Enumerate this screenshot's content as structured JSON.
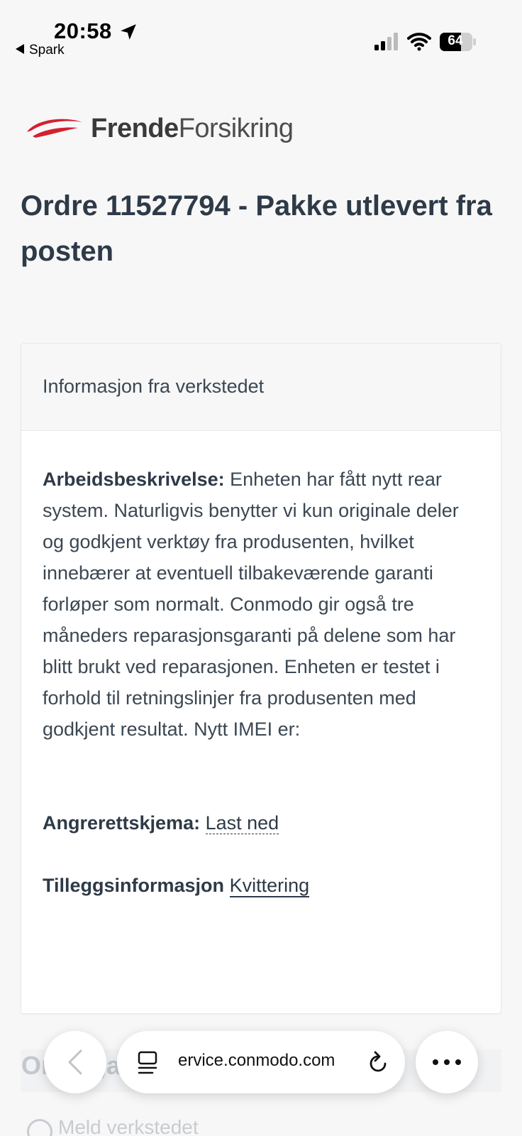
{
  "status_bar": {
    "time": "20:58",
    "back_app": "Spark",
    "battery": "64"
  },
  "logo": {
    "part1": "Frende",
    "part2": "Forsikring",
    "accent_color": "#d5202e"
  },
  "page": {
    "title": "Ordre 11527794 - Pakke utlevert fra posten"
  },
  "card": {
    "header": "Informasjon fra verkstedet",
    "work_description_label": "Arbeidsbeskrivelse:",
    "work_description_text": "Enheten har fått nytt rear system. Naturligvis benytter vi kun originale deler og godkjent verktøy fra produsenten, hvilket innebærer at eventuell tilbakeværende garanti forløper som normalt. Conmodo gir også tre måneders reparasjonsgaranti på delene som har blitt brukt ved reparasjonen. Enheten er testet i forhold til retningslinjer fra produsenten med godkjent resultat. Nytt IMEI er:",
    "withdrawal_label": "Angrerettskjema:",
    "withdrawal_link": "Last ned",
    "extra_label": "Tilleggsinformasjon",
    "extra_link": "Kvittering"
  },
  "below": {
    "section_title": "Ordregang",
    "radio_label": "Meld verkstedet"
  },
  "browser": {
    "url": "ervice.conmodo.com"
  }
}
